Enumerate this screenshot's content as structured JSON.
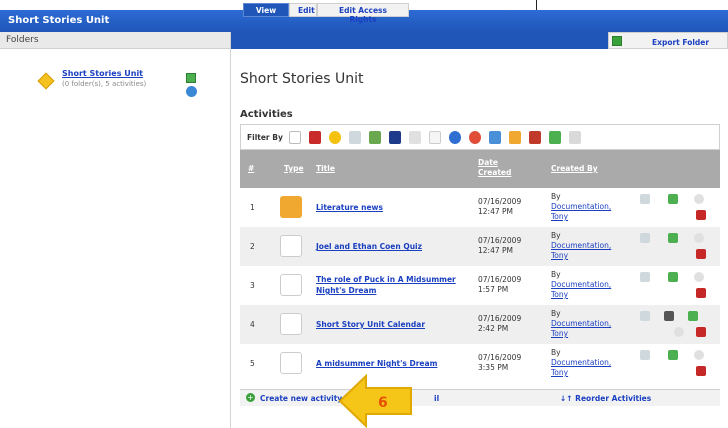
{
  "header": {
    "title": "Short Stories Unit"
  },
  "folders": {
    "heading": "Folders",
    "item": {
      "name": "Short Stories Unit",
      "sub": "(0 folder(s), 5 activities)"
    }
  },
  "tabs": {
    "view": "View",
    "edit": "Edit",
    "edit_access": "Edit Access Rights"
  },
  "export_label": "Export Folder",
  "main": {
    "title": "Short Stories Unit",
    "section": "Activities",
    "filter_label": "Filter By"
  },
  "table": {
    "headers": {
      "num": "#",
      "type": "Type",
      "title": "Title",
      "date1": "Date",
      "date2": "Created",
      "created_by": "Created By"
    },
    "rows": [
      {
        "num": "1",
        "title": "Literature news",
        "date": "07/16/2009",
        "time": "12:47 PM",
        "by": "By",
        "author1": "Documentation,",
        "author2": "Tony"
      },
      {
        "num": "2",
        "title": "Joel and Ethan Coen Quiz",
        "date": "07/16/2009",
        "time": "12:47 PM",
        "by": "By",
        "author1": "Documentation,",
        "author2": "Tony"
      },
      {
        "num": "3",
        "title1": "The role of Puck in A Midsummer",
        "title2": "Night's Dream",
        "date": "07/16/2009",
        "time": "1:57 PM",
        "by": "By",
        "author1": "Documentation,",
        "author2": "Tony"
      },
      {
        "num": "4",
        "title": "Short Story Unit Calendar",
        "date": "07/16/2009",
        "time": "2:42 PM",
        "by": "By",
        "author1": "Documentation,",
        "author2": "Tony"
      },
      {
        "num": "5",
        "title": "A midsummer Night's Dream",
        "date": "07/16/2009",
        "time": "3:35 PM",
        "by": "By",
        "author1": "Documentation,",
        "author2": "Tony"
      }
    ]
  },
  "footer": {
    "create": "Create new activity",
    "fragment": "il",
    "reorder": "↓↑ Reorder Activities"
  },
  "callout": {
    "number": "6",
    "color": "#f5c518"
  },
  "colors": {
    "brand": "#1f56b8",
    "link": "#1a3fc0",
    "header_gray": "#aaaaaa"
  }
}
